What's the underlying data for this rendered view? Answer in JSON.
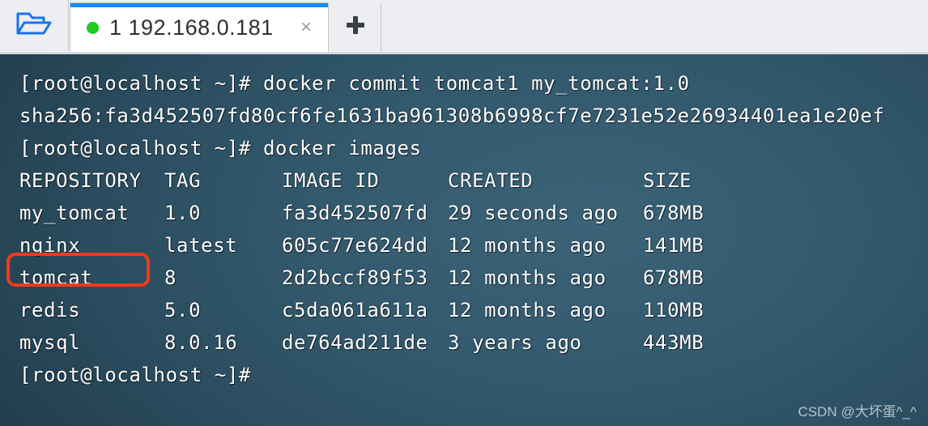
{
  "tabbar": {
    "folder_icon": "open-folder-icon",
    "tab": {
      "status_dot": "green-status-dot",
      "title": "1 192.168.0.181",
      "close_label": "×"
    },
    "new_tab_label": "+"
  },
  "terminal": {
    "prompt": "[root@localhost ~]#",
    "lines": [
      {
        "kind": "command",
        "text": "[root@localhost ~]# docker commit tomcat1 my_tomcat:1.0"
      },
      {
        "kind": "output",
        "text": "sha256:fa3d452507fd80cf6fe1631ba961308b6998cf7e7231e52e26934401ea1e20ef"
      },
      {
        "kind": "command",
        "text": "[root@localhost ~]# docker images"
      }
    ],
    "table": {
      "headers": [
        "REPOSITORY",
        "TAG",
        "IMAGE ID",
        "CREATED",
        "SIZE"
      ],
      "rows": [
        {
          "repository": "my_tomcat",
          "tag": "1.0",
          "image_id": "fa3d452507fd",
          "created": "29 seconds ago",
          "size": "678MB",
          "highlighted": true
        },
        {
          "repository": "nginx",
          "tag": "latest",
          "image_id": "605c77e624dd",
          "created": "12 months ago",
          "size": "141MB",
          "highlighted": false
        },
        {
          "repository": "tomcat",
          "tag": "8",
          "image_id": "2d2bccf89f53",
          "created": "12 months ago",
          "size": "678MB",
          "highlighted": false
        },
        {
          "repository": "redis",
          "tag": "5.0",
          "image_id": "c5da061a611a",
          "created": "12 months ago",
          "size": "110MB",
          "highlighted": false
        },
        {
          "repository": "mysql",
          "tag": "8.0.16",
          "image_id": "de764ad211de",
          "created": "3 years ago",
          "size": "443MB",
          "highlighted": false
        }
      ]
    },
    "final_prompt": "[root@localhost ~]#",
    "highlight_color": "#f23a1b"
  },
  "watermark": {
    "text": "CSDN @大坏蛋^_^"
  }
}
